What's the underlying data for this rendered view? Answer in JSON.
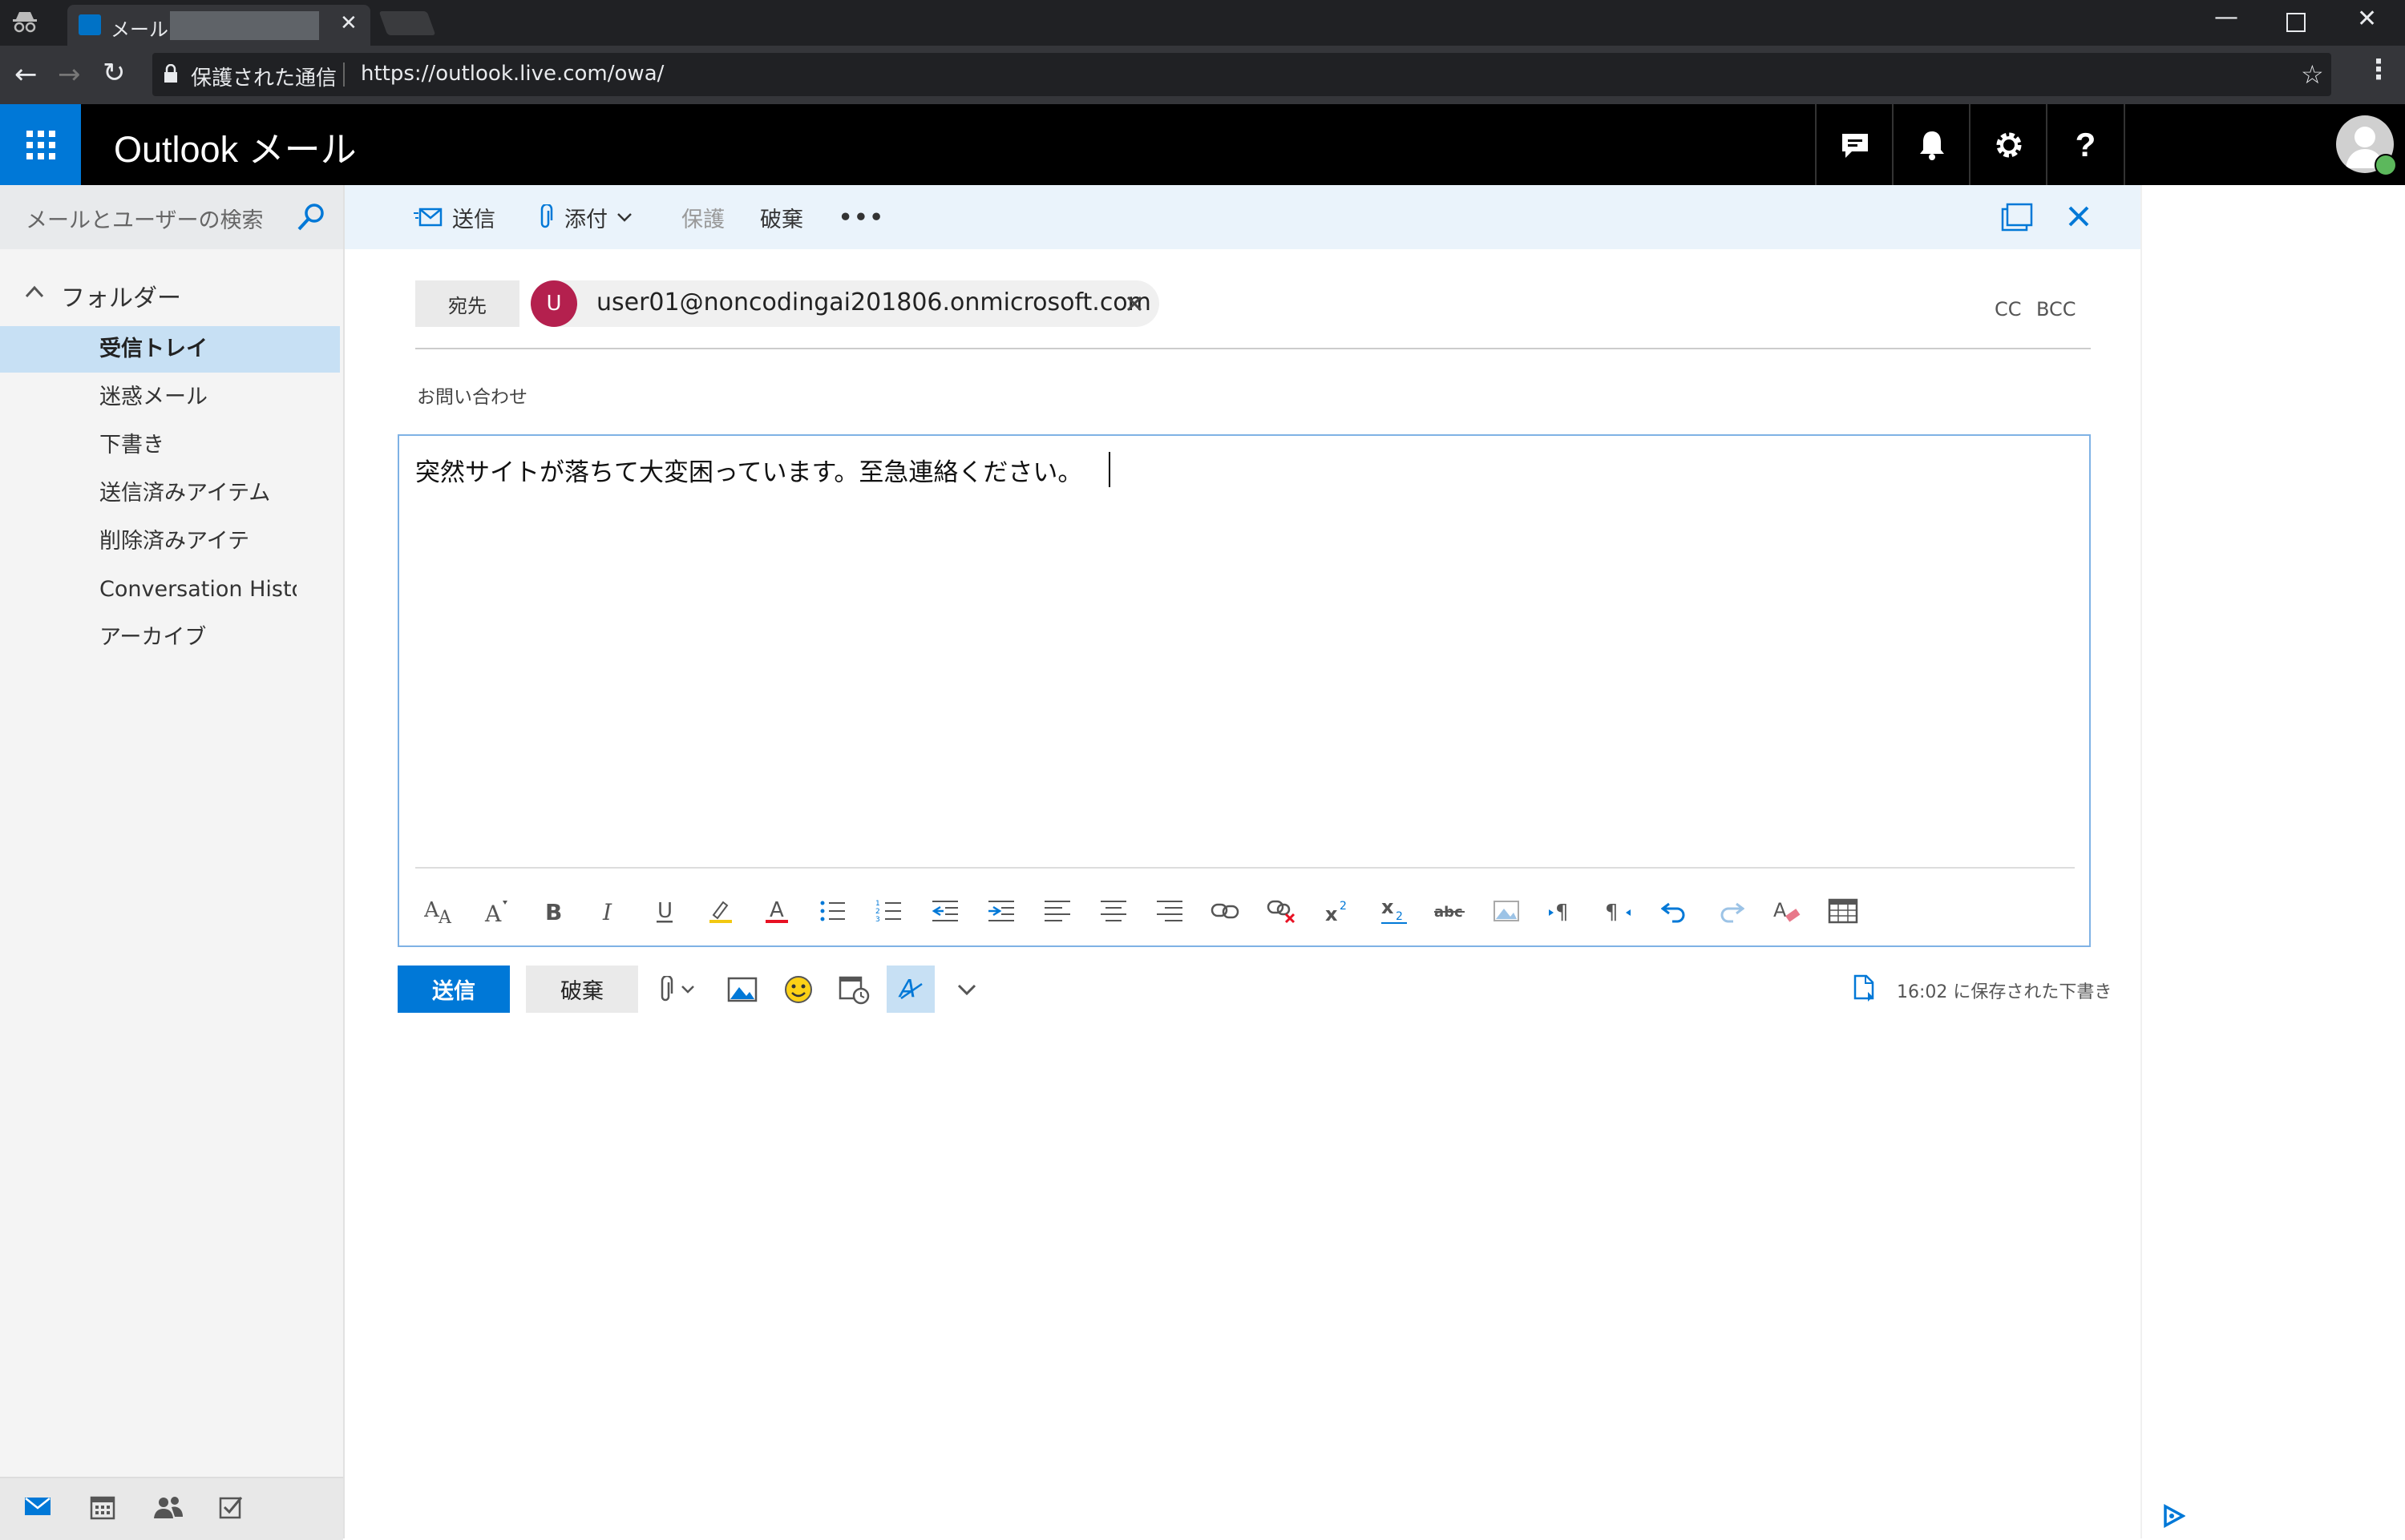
{
  "browser": {
    "tab_title": "メール -",
    "address_secure": "保護された通信",
    "address_url": "https://outlook.live.com/owa/"
  },
  "app": {
    "title": "Outlook メール"
  },
  "header_buttons": [
    "chat-icon",
    "bell-icon",
    "gear-icon",
    "help-icon"
  ],
  "sidebar": {
    "search_placeholder": "メールとユーザーの検索",
    "folders_header": "フォルダー",
    "folders": [
      {
        "label": "受信トレイ",
        "selected": true
      },
      {
        "label": "迷惑メール"
      },
      {
        "label": "下書き"
      },
      {
        "label": "送信済みアイテム"
      },
      {
        "label": "削除済みアイテ"
      },
      {
        "label": "Conversation Histo"
      },
      {
        "label": "アーカイブ"
      }
    ]
  },
  "toolbar": {
    "send": "送信",
    "attach": "添付",
    "protect": "保護",
    "discard": "破棄",
    "more": "•••"
  },
  "compose": {
    "to_label": "宛先",
    "recipient_initial": "U",
    "recipient": "user01@noncodingai201806.onmicrosoft.com",
    "cc": "CC",
    "bcc": "BCC",
    "subject": "お問い合わせ",
    "body": "突然サイトが落ちて大変困っています。至急連絡ください。",
    "send_button": "送信",
    "discard_button": "破棄",
    "saved_status": "16:02 に保存された下書き"
  },
  "colors": {
    "accent": "#0078d7",
    "selected_folder": "#c7e0f4",
    "avatar": "#b4204e"
  }
}
